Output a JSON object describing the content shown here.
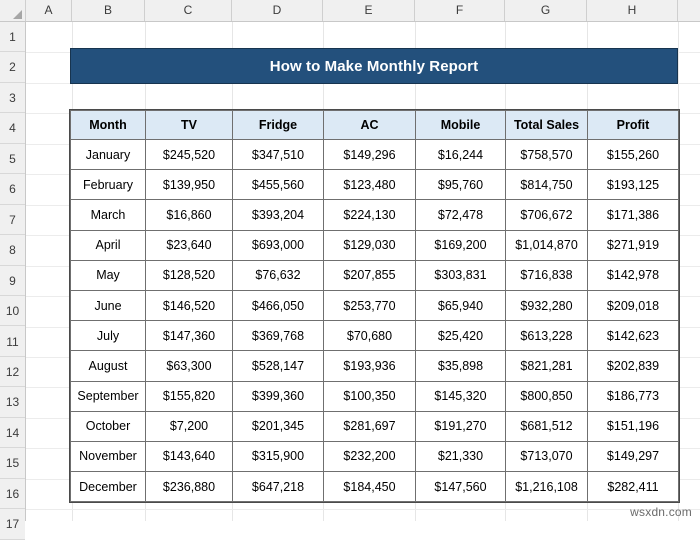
{
  "sheet": {
    "column_headers": [
      "A",
      "B",
      "C",
      "D",
      "E",
      "F",
      "G",
      "H"
    ],
    "row_headers": [
      "1",
      "2",
      "3",
      "4",
      "5",
      "6",
      "7",
      "8",
      "9",
      "10",
      "11",
      "12",
      "13",
      "14",
      "15",
      "16",
      "17"
    ],
    "select_all_icon": "select-all-triangle-icon"
  },
  "title": {
    "text": "How to Make Monthly Report",
    "background_color": "#23507c",
    "text_color": "#ffffff"
  },
  "table": {
    "header_background_color": "#dce9f5",
    "border_color": "#6f6f6f",
    "columns": [
      "Month",
      "TV",
      "Fridge",
      "AC",
      "Mobile",
      "Total Sales",
      "Profit"
    ],
    "rows": [
      [
        "January",
        "$245,520",
        "$347,510",
        "$149,296",
        "$16,244",
        "$758,570",
        "$155,260"
      ],
      [
        "February",
        "$139,950",
        "$455,560",
        "$123,480",
        "$95,760",
        "$814,750",
        "$193,125"
      ],
      [
        "March",
        "$16,860",
        "$393,204",
        "$224,130",
        "$72,478",
        "$706,672",
        "$171,386"
      ],
      [
        "April",
        "$23,640",
        "$693,000",
        "$129,030",
        "$169,200",
        "$1,014,870",
        "$271,919"
      ],
      [
        "May",
        "$128,520",
        "$76,632",
        "$207,855",
        "$303,831",
        "$716,838",
        "$142,978"
      ],
      [
        "June",
        "$146,520",
        "$466,050",
        "$253,770",
        "$65,940",
        "$932,280",
        "$209,018"
      ],
      [
        "July",
        "$147,360",
        "$369,768",
        "$70,680",
        "$25,420",
        "$613,228",
        "$142,623"
      ],
      [
        "August",
        "$63,300",
        "$528,147",
        "$193,936",
        "$35,898",
        "$821,281",
        "$202,839"
      ],
      [
        "September",
        "$155,820",
        "$399,360",
        "$100,350",
        "$145,320",
        "$800,850",
        "$186,773"
      ],
      [
        "October",
        "$7,200",
        "$201,345",
        "$281,697",
        "$191,270",
        "$681,512",
        "$151,196"
      ],
      [
        "November",
        "$143,640",
        "$315,900",
        "$232,200",
        "$21,330",
        "$713,070",
        "$149,297"
      ],
      [
        "December",
        "$236,880",
        "$647,218",
        "$184,450",
        "$147,560",
        "$1,216,108",
        "$282,411"
      ]
    ]
  },
  "watermark": {
    "text": "wsxdn.com"
  }
}
